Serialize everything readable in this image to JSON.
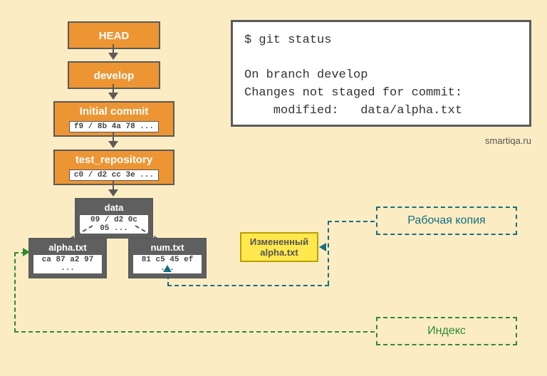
{
  "nodes": {
    "head": {
      "label": "HEAD"
    },
    "develop": {
      "label": "develop"
    },
    "commit": {
      "label": "Initial commit",
      "hash": "f9 / 8b 4a 78 ..."
    },
    "repo": {
      "label": "test_repository",
      "hash": "c0 / d2 cc 3e ..."
    },
    "data": {
      "label": "data",
      "hash": "09 / d2 0c 05 ..."
    },
    "alpha": {
      "label": "alpha.txt",
      "hash": "ca 87 a2 97 ..."
    },
    "num": {
      "label": "num.txt",
      "hash": "81 c5 45 ef ..."
    }
  },
  "terminal": {
    "line1": "$ git status",
    "line2": "",
    "line3": "On branch develop",
    "line4": "Changes not staged for commit:",
    "line5": "    modified:   data/alpha.txt"
  },
  "attribution": "smartiqa.ru",
  "changed": {
    "line1": "Измененный",
    "line2": "alpha.txt"
  },
  "labels": {
    "working_copy": "Рабочая копия",
    "index": "Индекс"
  }
}
